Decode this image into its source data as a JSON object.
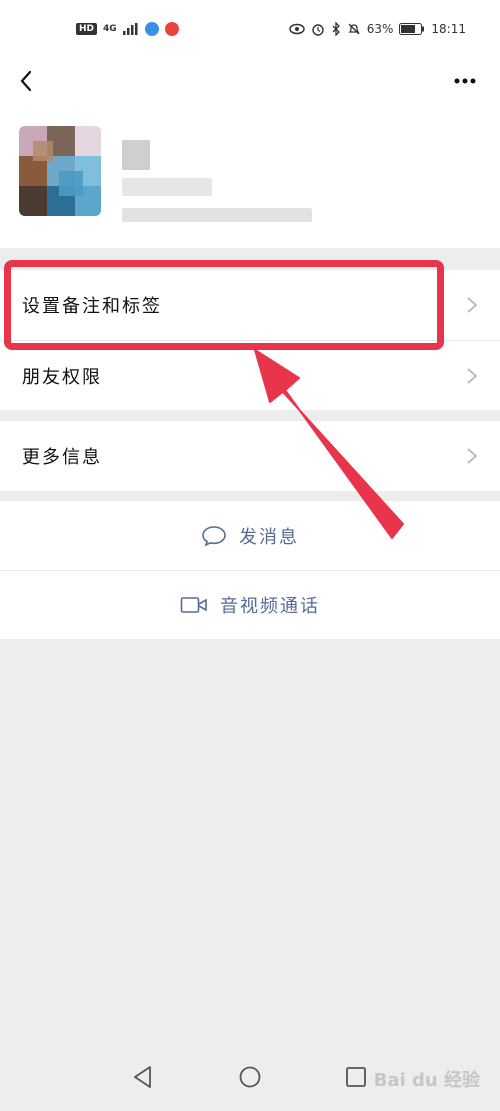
{
  "status_bar": {
    "hd_badge": "HD",
    "network": "4G",
    "battery_pct": "63%",
    "time": "18:11"
  },
  "menu": {
    "items": [
      {
        "label": "设置备注和标签"
      },
      {
        "label": "朋友权限"
      },
      {
        "label": "更多信息"
      }
    ]
  },
  "actions": {
    "send_message": "发消息",
    "video_call": "音视频通话"
  },
  "watermark": "Bai du 经验",
  "colors": {
    "accent_link": "#576b95",
    "highlight_red": "#e8354b",
    "background": "#ededed"
  },
  "icons": {
    "back": "chevron-left-icon",
    "more": "more-dots-icon",
    "chevron": "chevron-right-icon",
    "message": "chat-bubble-icon",
    "video": "video-camera-icon"
  }
}
